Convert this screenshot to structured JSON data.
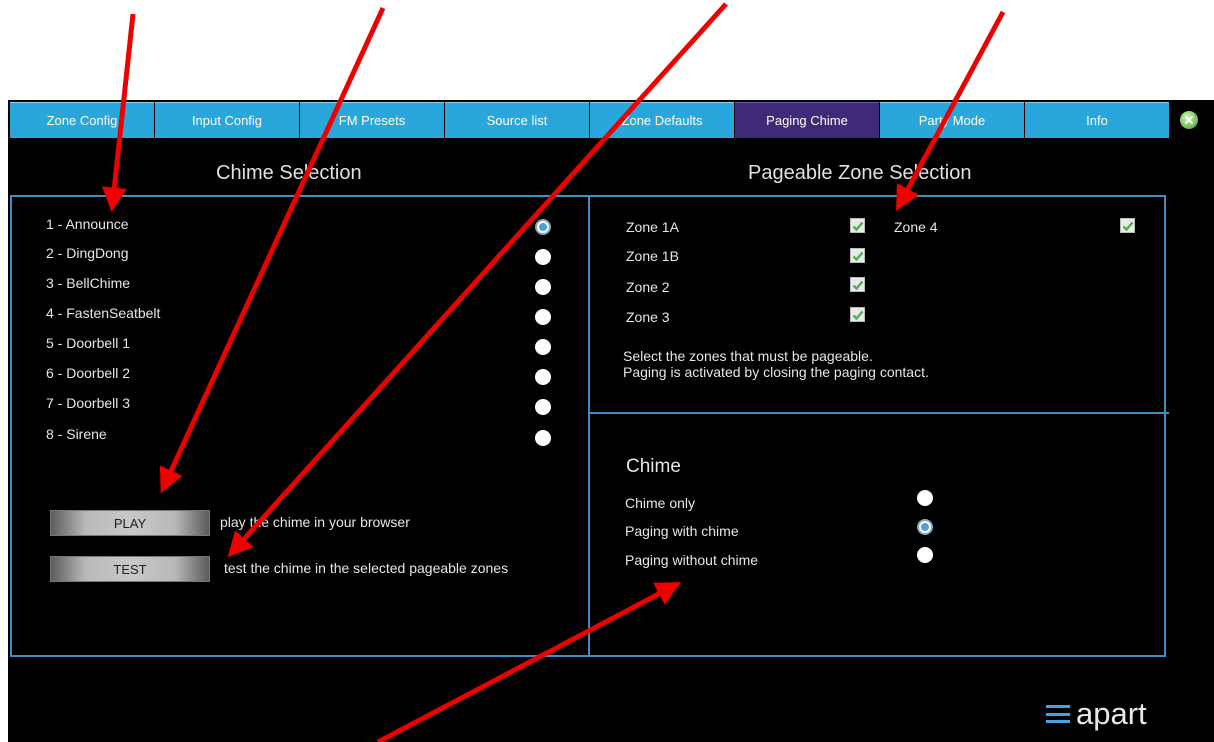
{
  "tabs": [
    {
      "label": "Zone Config",
      "active": false
    },
    {
      "label": "Input Config",
      "active": false
    },
    {
      "label": "FM Presets",
      "active": false
    },
    {
      "label": "Source list",
      "active": false
    },
    {
      "label": "Zone Defaults",
      "active": false
    },
    {
      "label": "Paging Chime",
      "active": true
    },
    {
      "label": "Party Mode",
      "active": false
    },
    {
      "label": "Info",
      "active": false
    }
  ],
  "chime_selection": {
    "title": "Chime Selection",
    "items": [
      {
        "label": "1 - Announce",
        "selected": true
      },
      {
        "label": "2 - DingDong",
        "selected": false
      },
      {
        "label": "3 - BellChime",
        "selected": false
      },
      {
        "label": "4 - FastenSeatbelt",
        "selected": false
      },
      {
        "label": "5 - Doorbell 1",
        "selected": false
      },
      {
        "label": "6 - Doorbell 2",
        "selected": false
      },
      {
        "label": "7 - Doorbell 3",
        "selected": false
      },
      {
        "label": "8 - Sirene",
        "selected": false
      }
    ],
    "play": {
      "label": "PLAY",
      "desc": "play the chime in your browser"
    },
    "test": {
      "label": "TEST",
      "desc": "test the chime in the selected pageable zones"
    }
  },
  "pageable_zones": {
    "title": "Pageable Zone Selection",
    "zones": [
      {
        "label": "Zone 1A",
        "checked": true
      },
      {
        "label": "Zone 1B",
        "checked": true
      },
      {
        "label": "Zone 2",
        "checked": true
      },
      {
        "label": "Zone 3",
        "checked": true
      },
      {
        "label": "Zone 4",
        "checked": true
      }
    ],
    "help_line1": "Select the zones that must be pageable.",
    "help_line2": "Paging is activated by closing the paging contact."
  },
  "chime_mode": {
    "title": "Chime",
    "options": [
      {
        "label": "Chime only",
        "selected": false
      },
      {
        "label": "Paging with chime",
        "selected": true
      },
      {
        "label": "Paging without chime",
        "selected": false
      }
    ]
  },
  "logo": {
    "text": "apart"
  },
  "colors": {
    "tab": "#29a7dd",
    "tab_active": "#3f2a78",
    "panel_border": "#3f8fc6",
    "check": "#4caf50",
    "arrow": "#ee0000"
  }
}
